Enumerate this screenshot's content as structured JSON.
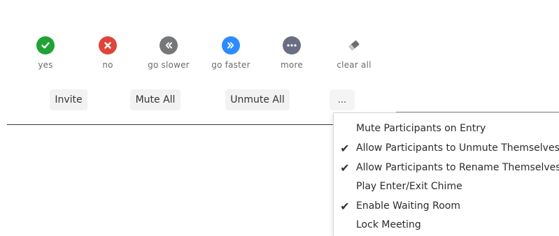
{
  "feedback": {
    "items": [
      {
        "label": "yes",
        "icon": "check-icon",
        "color": "#1fa336"
      },
      {
        "label": "no",
        "icon": "close-icon",
        "color": "#e0453a"
      },
      {
        "label": "go slower",
        "icon": "rewind-icon",
        "color": "#757779"
      },
      {
        "label": "go faster",
        "icon": "fast-forward-icon",
        "color": "#2d8cff"
      },
      {
        "label": "more",
        "icon": "ellipsis-icon",
        "color": "#6a6e85"
      },
      {
        "label": "clear all",
        "icon": "eraser-icon",
        "color": "#7a7a7a"
      }
    ]
  },
  "actions": {
    "invite_label": "Invite",
    "mute_all_label": "Mute All",
    "unmute_all_label": "Unmute All",
    "more_label": "..."
  },
  "menu": {
    "items": [
      {
        "label": "Mute Participants on Entry",
        "checked": false,
        "check_glyph": ""
      },
      {
        "label": "Allow Participants to Unmute Themselves",
        "checked": true,
        "check_glyph": "✔"
      },
      {
        "label": "Allow Participants to Rename Themselves",
        "checked": true,
        "check_glyph": "✔"
      },
      {
        "label": "Play Enter/Exit Chime",
        "checked": false,
        "check_glyph": ""
      },
      {
        "label": "Enable Waiting Room",
        "checked": true,
        "check_glyph": "✔"
      },
      {
        "label": "Lock Meeting",
        "checked": false,
        "check_glyph": ""
      }
    ]
  }
}
